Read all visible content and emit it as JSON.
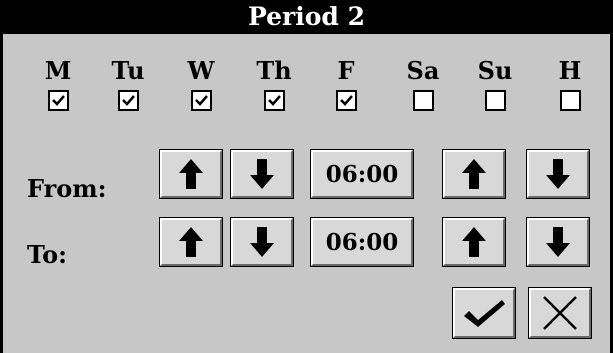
{
  "title": "Period 2",
  "days": [
    {
      "label": "M",
      "checked": true
    },
    {
      "label": "Tu",
      "checked": true
    },
    {
      "label": "W",
      "checked": true
    },
    {
      "label": "Th",
      "checked": true
    },
    {
      "label": "F",
      "checked": true
    },
    {
      "label": "Sa",
      "checked": false
    },
    {
      "label": "Su",
      "checked": false
    },
    {
      "label": "H",
      "checked": false
    }
  ],
  "from": {
    "label": "From:",
    "time": "06:00"
  },
  "to": {
    "label": "To:",
    "time": "06:00"
  },
  "icons": {
    "up": "arrow-up-icon",
    "down": "arrow-down-icon",
    "confirm": "checkmark-icon",
    "cancel": "close-icon"
  }
}
